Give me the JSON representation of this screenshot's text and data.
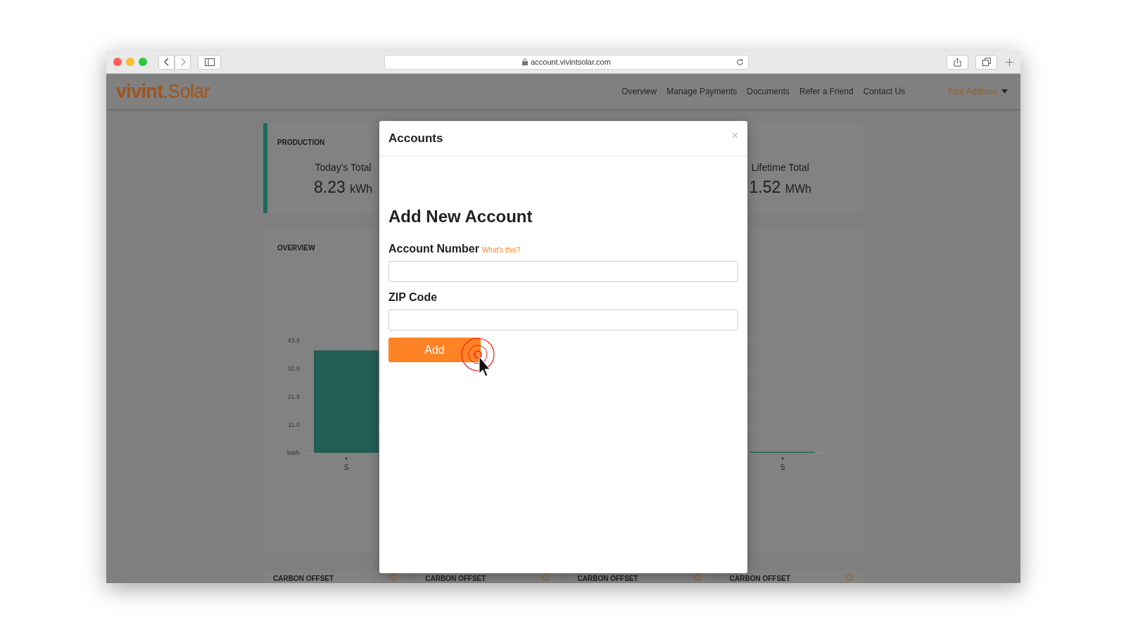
{
  "browser": {
    "url": "account.vivintsolar.com"
  },
  "site": {
    "logo_bold": "vivint",
    "logo_rest": ".Solar",
    "nav": [
      "Overview",
      "Manage Payments",
      "Documents",
      "Refer a Friend",
      "Contact Us"
    ],
    "account_menu": "Your Address"
  },
  "production": {
    "title": "PRODUCTION",
    "stats": [
      {
        "label": "Today's Total",
        "value": "8.23",
        "unit": "kWh"
      },
      {
        "label": "Lifetime Total",
        "value": "1.52",
        "unit": "MWh"
      }
    ]
  },
  "overview": {
    "title": "OVERVIEW",
    "chart_data": {
      "type": "bar",
      "categories": [
        "S",
        "S"
      ],
      "values": [
        40.0,
        0.4
      ],
      "ylim": [
        0,
        43.9
      ],
      "yticks": [
        {
          "value": 0,
          "label": "kWh"
        },
        {
          "value": 11,
          "label": "11.0"
        },
        21.9,
        32.9,
        43.9
      ]
    }
  },
  "carbon_cards": [
    {
      "title": "CARBON OFFSET"
    },
    {
      "title": "CARBON OFFSET"
    },
    {
      "title": "CARBON OFFSET"
    },
    {
      "title": "CARBON OFFSET"
    }
  ],
  "modal": {
    "title": "Accounts",
    "close": "×",
    "heading": "Add New Account",
    "fields": [
      {
        "label": "Account Number",
        "help": "What's this?"
      },
      {
        "label": "ZIP Code"
      }
    ],
    "submit": "Add"
  }
}
